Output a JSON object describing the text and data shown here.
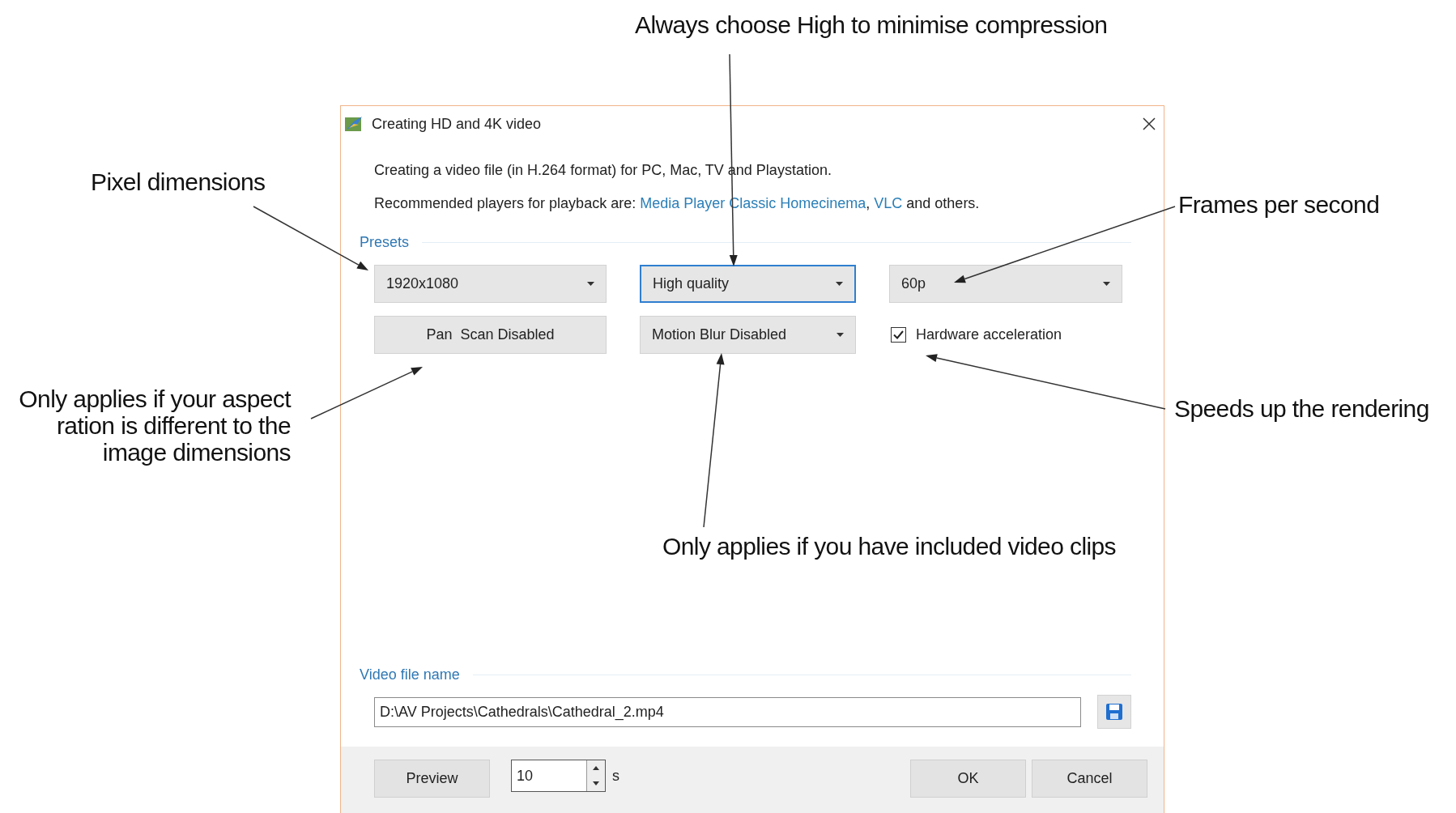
{
  "annotations": [
    {
      "text": "Always choose High to minimise compression"
    },
    {
      "text": "Pixel dimensions"
    },
    {
      "text": "Frames per second"
    },
    {
      "text": "Only applies if your aspect\nration is different to the\nimage dimensions"
    },
    {
      "text": "Speeds up the rendering"
    },
    {
      "text": "Only applies if you have included video clips"
    }
  ],
  "dialog": {
    "title": "Creating HD and 4K video",
    "intro": "Creating a video file (in H.264 format) for PC, Mac, TV and Playstation.",
    "players": [
      {
        "kind": "text",
        "text": "Recommended players for playback are: "
      },
      {
        "kind": "link",
        "text": "Media Player Classic Homecinema"
      },
      {
        "kind": "text",
        "text": ", "
      },
      {
        "kind": "link",
        "text": "VLC"
      },
      {
        "kind": "text",
        "text": " and others."
      }
    ],
    "presets": {
      "label": "Presets",
      "controls": [
        {
          "kind": "dropdown",
          "value": "1920x1080",
          "focused": false
        },
        {
          "kind": "dropdown",
          "value": "High quality",
          "focused": true
        },
        {
          "kind": "dropdown",
          "value": "60p",
          "focused": false
        },
        {
          "kind": "button",
          "label": "Pan  Scan Disabled"
        },
        {
          "kind": "dropdown",
          "value": "Motion Blur Disabled",
          "focused": false
        },
        {
          "kind": "checkbox",
          "label": "Hardware acceleration",
          "checked": true
        }
      ]
    },
    "file": {
      "label": "Video file name",
      "value": "D:\\AV Projects\\Cathedrals\\Cathedral_2.mp4"
    },
    "footer": {
      "preview": "Preview",
      "duration": "10",
      "unit": "s",
      "ok": "OK",
      "cancel": "Cancel"
    }
  }
}
